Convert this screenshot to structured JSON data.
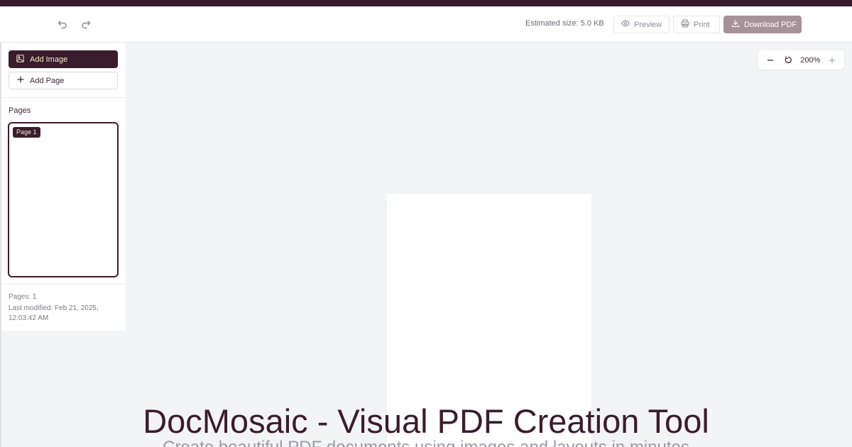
{
  "toolbar": {
    "undo_icon": "undo-icon",
    "redo_icon": "redo-icon",
    "estimated_size": "Estimated size: 5.0 KB",
    "preview_label": "Preview",
    "print_label": "Print",
    "download_label": "Download PDF"
  },
  "sidebar": {
    "add_image_label": "Add Image",
    "add_page_label": "Add Page",
    "pages_heading": "Pages",
    "pages": [
      {
        "tag": "Page 1",
        "selected": true
      }
    ],
    "footer": {
      "pages_count": "Pages: 1",
      "last_modified": "Last modified: Feb 21, 2025,",
      "last_modified_time": "12:03:42 AM"
    }
  },
  "zoom": {
    "level": "200%"
  },
  "overlay": {
    "title": "DocMosaic - Visual PDF Creation Tool",
    "subtitle": "Create beautiful PDF documents using images and layouts in minutes"
  },
  "colors": {
    "brand_dark": "#3a1d2c",
    "brand_accent_text": "#fbe6c7",
    "download_disabled": "#a59399",
    "canvas_bg": "#f3f4f6"
  }
}
